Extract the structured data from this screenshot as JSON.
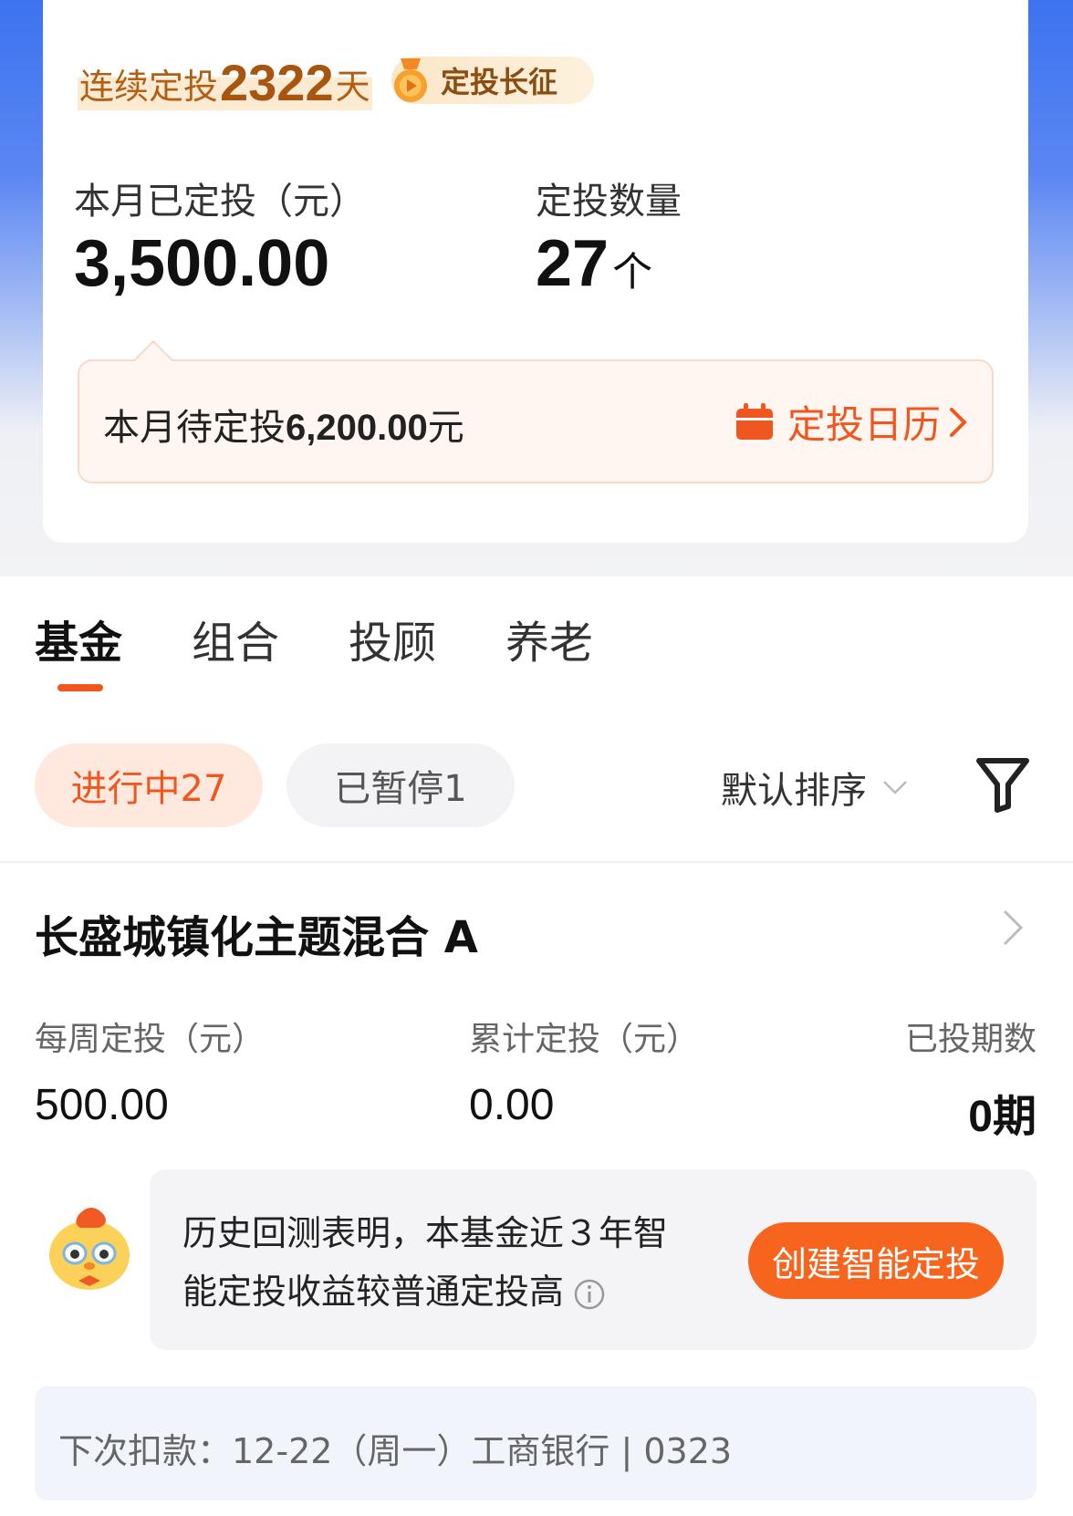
{
  "summary": {
    "streak_prefix": "连续定投",
    "streak_days": "2322",
    "streak_suffix": "天",
    "badge_label": "定投长征",
    "month_invested_label": "本月已定投（元）",
    "month_invested_value": "3,500.00",
    "plan_count_label": "定投数量",
    "plan_count_value": "27",
    "plan_count_unit": "个",
    "pending_prefix": "本月待定投",
    "pending_amount": "6,200.00",
    "pending_suffix": "元",
    "calendar_label": "定投日历"
  },
  "tabs": [
    {
      "label": "基金",
      "active": true
    },
    {
      "label": "组合",
      "active": false
    },
    {
      "label": "投顾",
      "active": false
    },
    {
      "label": "养老",
      "active": false
    }
  ],
  "filters": {
    "active_chip": "进行中27",
    "paused_chip": "已暂停1",
    "sort_label": "默认排序"
  },
  "fund": {
    "name": "长盛城镇化主题混合 A",
    "cols": [
      {
        "label": "每周定投（元）",
        "value": "500.00"
      },
      {
        "label": "累计定投（元）",
        "value": "0.00"
      },
      {
        "label": "已投期数",
        "value": "0期"
      }
    ],
    "tip_line1": "历史回测表明，本基金近３年智",
    "tip_line2": "能定投收益较普通定投高",
    "smart_button": "创建智能定投",
    "next_debit": "下次扣款：12-22（周一）工商银行 | 0323"
  },
  "colors": {
    "accent": "#f0571e",
    "brand_blue": "#3d73f0",
    "streak_gold": "#a8560f"
  }
}
